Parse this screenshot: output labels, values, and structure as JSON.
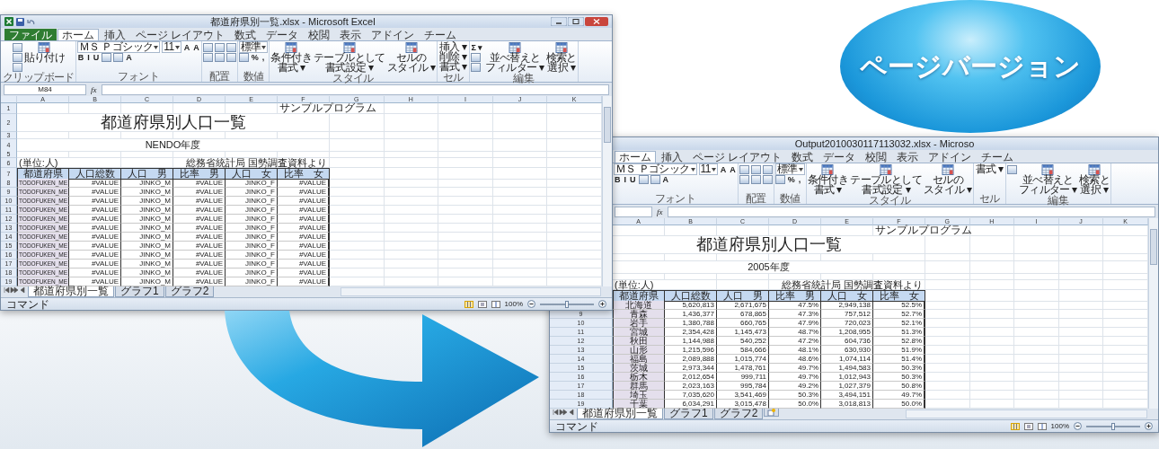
{
  "heading": {
    "text": "ページバージョン"
  },
  "windows": [
    {
      "title": "都道府県別一覧.xlsx - Microsoft Excel",
      "quick_access": true,
      "window_controls": true,
      "tabs": [
        {
          "label": "ファイル",
          "kind": "file",
          "selected": false
        },
        {
          "label": "ホーム",
          "kind": "tab",
          "selected": true
        },
        {
          "label": "挿入",
          "kind": "tab",
          "selected": false
        },
        {
          "label": "ページ レイアウト",
          "kind": "tab",
          "selected": false
        },
        {
          "label": "数式",
          "kind": "tab",
          "selected": false
        },
        {
          "label": "データ",
          "kind": "tab",
          "selected": false
        },
        {
          "label": "校閲",
          "kind": "tab",
          "selected": false
        },
        {
          "label": "表示",
          "kind": "tab",
          "selected": false
        },
        {
          "label": "アドイン",
          "kind": "tab",
          "selected": false
        },
        {
          "label": "チーム",
          "kind": "tab",
          "selected": false
        }
      ],
      "ribbon": [
        {
          "label": "クリップボード",
          "big": [
            {
              "lines": [
                "貼り付け"
              ]
            }
          ],
          "rows": [
            {
              "items": [
                {
                  "kind": "tool"
                }
              ]
            },
            {
              "items": [
                {
                  "kind": "tool"
                }
              ]
            },
            {
              "items": [
                {
                  "kind": "tool"
                }
              ]
            }
          ]
        },
        {
          "label": "フォント",
          "rows": [
            {
              "items": [
                {
                  "kind": "field",
                  "value": "ＭＳ Ｐゴシック"
                },
                {
                  "kind": "field",
                  "value": "11"
                },
                {
                  "kind": "glyph",
                  "text": "A"
                },
                {
                  "kind": "glyph",
                  "text": "A"
                }
              ]
            },
            {
              "items": [
                {
                  "kind": "glyph",
                  "text": "B"
                },
                {
                  "kind": "glyph",
                  "text": "I"
                },
                {
                  "kind": "glyph",
                  "text": "U"
                },
                {
                  "kind": "tool"
                },
                {
                  "kind": "tool"
                },
                {
                  "kind": "glyph",
                  "text": "A"
                }
              ]
            }
          ]
        },
        {
          "label": "配置",
          "rows": [
            {
              "items": [
                {
                  "kind": "tool"
                },
                {
                  "kind": "tool"
                },
                {
                  "kind": "tool"
                }
              ]
            },
            {
              "items": [
                {
                  "kind": "tool"
                },
                {
                  "kind": "tool"
                },
                {
                  "kind": "tool"
                }
              ]
            }
          ]
        },
        {
          "label": "数値",
          "rows": [
            {
              "items": [
                {
                  "kind": "field",
                  "value": "標準"
                }
              ]
            },
            {
              "items": [
                {
                  "kind": "tool"
                },
                {
                  "kind": "glyph",
                  "text": "%"
                },
                {
                  "kind": "glyph",
                  "text": ","
                }
              ]
            }
          ]
        },
        {
          "label": "スタイル",
          "big": [
            {
              "lines": [
                "条件付き",
                "書式 ▾"
              ]
            },
            {
              "lines": [
                "テーブルとして",
                "書式設定 ▾"
              ]
            },
            {
              "lines": [
                "セルの",
                "スタイル ▾"
              ]
            }
          ]
        },
        {
          "label": "セル",
          "rows": [
            {
              "items": [
                {
                  "kind": "button",
                  "text": "挿入 ▾"
                }
              ]
            },
            {
              "items": [
                {
                  "kind": "button",
                  "text": "削除 ▾"
                }
              ]
            },
            {
              "items": [
                {
                  "kind": "button",
                  "text": "書式 ▾"
                }
              ]
            }
          ]
        },
        {
          "label": "編集",
          "rows": [
            {
              "items": [
                {
                  "kind": "glyph",
                  "text": "Σ ▾"
                }
              ]
            },
            {
              "items": [
                {
                  "kind": "tool"
                }
              ]
            },
            {
              "items": [
                {
                  "kind": "tool"
                }
              ]
            }
          ],
          "big": [
            {
              "lines": [
                "並べ替えと",
                "フィルター ▾"
              ]
            },
            {
              "lines": [
                "検索と",
                "選択 ▾"
              ]
            }
          ]
        }
      ],
      "name_box": "M84",
      "formula_label": "fx",
      "columns": [
        "A",
        "B",
        "C",
        "D",
        "E",
        "F",
        "G",
        "H",
        "I",
        "J",
        "K"
      ],
      "rows": [
        {
          "n": "1",
          "kind": "corner",
          "label": "サンプルプログラム"
        },
        {
          "n": "2",
          "kind": "title",
          "title": "都道府県別人口一覧"
        },
        {
          "n": "3",
          "kind": "blank"
        },
        {
          "n": "4",
          "kind": "subtitle",
          "subtitle": "NENDO年度"
        },
        {
          "n": "5",
          "kind": "blank"
        },
        {
          "n": "6",
          "kind": "notes",
          "left": "(単位:人)",
          "right": "総務省統計局 国勢調査資料より"
        },
        {
          "n": "7",
          "kind": "header",
          "cells": [
            "都道府県",
            "人口総数",
            "人口　男",
            "比率　男",
            "人口　女",
            "比率　女"
          ]
        },
        {
          "n": "8",
          "kind": "data",
          "cells": [
            "TODOFUKEN_ME",
            "#VALUE",
            "JINKO_M",
            "#VALUE",
            "JINKO_F",
            "#VALUE"
          ]
        },
        {
          "n": "9",
          "kind": "data",
          "cells": [
            "TODOFUKEN_ME",
            "#VALUE",
            "JINKO_M",
            "#VALUE",
            "JINKO_F",
            "#VALUE"
          ]
        },
        {
          "n": "10",
          "kind": "data",
          "cells": [
            "TODOFUKEN_ME",
            "#VALUE",
            "JINKO_M",
            "#VALUE",
            "JINKO_F",
            "#VALUE"
          ]
        },
        {
          "n": "11",
          "kind": "data",
          "cells": [
            "TODOFUKEN_ME",
            "#VALUE",
            "JINKO_M",
            "#VALUE",
            "JINKO_F",
            "#VALUE"
          ]
        },
        {
          "n": "12",
          "kind": "data",
          "cells": [
            "TODOFUKEN_ME",
            "#VALUE",
            "JINKO_M",
            "#VALUE",
            "JINKO_F",
            "#VALUE"
          ]
        },
        {
          "n": "13",
          "kind": "data",
          "cells": [
            "TODOFUKEN_ME",
            "#VALUE",
            "JINKO_M",
            "#VALUE",
            "JINKO_F",
            "#VALUE"
          ]
        },
        {
          "n": "14",
          "kind": "data",
          "cells": [
            "TODOFUKEN_ME",
            "#VALUE",
            "JINKO_M",
            "#VALUE",
            "JINKO_F",
            "#VALUE"
          ]
        },
        {
          "n": "15",
          "kind": "data",
          "cells": [
            "TODOFUKEN_ME",
            "#VALUE",
            "JINKO_M",
            "#VALUE",
            "JINKO_F",
            "#VALUE"
          ]
        },
        {
          "n": "16",
          "kind": "data",
          "cells": [
            "TODOFUKEN_ME",
            "#VALUE",
            "JINKO_M",
            "#VALUE",
            "JINKO_F",
            "#VALUE"
          ]
        },
        {
          "n": "17",
          "kind": "data",
          "cells": [
            "TODOFUKEN_ME",
            "#VALUE",
            "JINKO_M",
            "#VALUE",
            "JINKO_F",
            "#VALUE"
          ]
        },
        {
          "n": "18",
          "kind": "data",
          "cells": [
            "TODOFUKEN_ME",
            "#VALUE",
            "JINKO_M",
            "#VALUE",
            "JINKO_F",
            "#VALUE"
          ]
        },
        {
          "n": "19",
          "kind": "data",
          "cells": [
            "TODOFUKEN_ME",
            "#VALUE",
            "JINKO_M",
            "#VALUE",
            "JINKO_F",
            "#VALUE"
          ]
        }
      ],
      "sheet_tabs": [
        {
          "label": "都道府県別一覧",
          "kind": "sheet",
          "selected": true
        },
        {
          "label": "グラフ1",
          "kind": "sheet",
          "selected": false
        },
        {
          "label": "グラフ2",
          "kind": "sheet",
          "selected": false
        }
      ],
      "status": "コマンド",
      "zoom": "100%",
      "zoom_slider": {
        "level": 0.5
      }
    },
    {
      "title": "Output2010030117113032.xlsx - Microso",
      "tabs": [
        {
          "label": "ホーム",
          "kind": "tab",
          "selected": true
        },
        {
          "label": "挿入",
          "kind": "tab",
          "selected": false
        },
        {
          "label": "ページ レイアウト",
          "kind": "tab",
          "selected": false
        },
        {
          "label": "数式",
          "kind": "tab",
          "selected": false
        },
        {
          "label": "データ",
          "kind": "tab",
          "selected": false
        },
        {
          "label": "校閲",
          "kind": "tab",
          "selected": false
        },
        {
          "label": "表示",
          "kind": "tab",
          "selected": false
        },
        {
          "label": "アドイン",
          "kind": "tab",
          "selected": false
        },
        {
          "label": "チーム",
          "kind": "tab",
          "selected": false
        }
      ],
      "ribbon": [
        {
          "label": "フォント",
          "rows": [
            {
              "items": [
                {
                  "kind": "field",
                  "value": "ＭＳ Ｐゴシック"
                },
                {
                  "kind": "field",
                  "value": "11"
                },
                {
                  "kind": "glyph",
                  "text": "A"
                },
                {
                  "kind": "glyph",
                  "text": "A"
                }
              ]
            },
            {
              "items": [
                {
                  "kind": "glyph",
                  "text": "B"
                },
                {
                  "kind": "glyph",
                  "text": "I"
                },
                {
                  "kind": "glyph",
                  "text": "U"
                },
                {
                  "kind": "tool"
                },
                {
                  "kind": "tool"
                },
                {
                  "kind": "glyph",
                  "text": "A"
                }
              ]
            }
          ]
        },
        {
          "label": "配置",
          "rows": [
            {
              "items": [
                {
                  "kind": "tool"
                },
                {
                  "kind": "tool"
                },
                {
                  "kind": "tool"
                }
              ]
            },
            {
              "items": [
                {
                  "kind": "tool"
                },
                {
                  "kind": "tool"
                },
                {
                  "kind": "tool"
                }
              ]
            }
          ]
        },
        {
          "label": "数値",
          "rows": [
            {
              "items": [
                {
                  "kind": "field",
                  "value": "標準"
                }
              ]
            },
            {
              "items": [
                {
                  "kind": "tool"
                },
                {
                  "kind": "glyph",
                  "text": "%"
                },
                {
                  "kind": "glyph",
                  "text": ","
                }
              ]
            }
          ]
        },
        {
          "label": "スタイル",
          "big": [
            {
              "lines": [
                "条件付き",
                "書式 ▾"
              ]
            },
            {
              "lines": [
                "テーブルとして",
                "書式設定 ▾"
              ]
            },
            {
              "lines": [
                "セルの",
                "スタイル ▾"
              ]
            }
          ]
        },
        {
          "label": "セル",
          "rows": [
            {
              "items": [
                {
                  "kind": "button",
                  "text": "書式 ▾"
                }
              ]
            }
          ]
        },
        {
          "label": "編集",
          "rows": [
            {
              "items": [
                {
                  "kind": "tool"
                }
              ]
            }
          ],
          "big": [
            {
              "lines": [
                "並べ替えと",
                "フィルター ▾"
              ]
            },
            {
              "lines": [
                "検索と",
                "選択 ▾"
              ]
            }
          ]
        }
      ],
      "formula_label": "fx",
      "columns": [
        "A",
        "B",
        "C",
        "D",
        "E",
        "F",
        "G",
        "H",
        "I",
        "J",
        "K"
      ],
      "rows": [
        {
          "kind": "corner",
          "label": "サンプルプログラム"
        },
        {
          "kind": "title",
          "title": "都道府県別人口一覧"
        },
        {
          "kind": "blank"
        },
        {
          "kind": "subtitle",
          "subtitle": "2005年度"
        },
        {
          "kind": "blank"
        },
        {
          "kind": "notes",
          "left": "(単位:人)",
          "right": "総務省統計局 国勢調査資料より"
        },
        {
          "kind": "header",
          "cells": [
            "都道府県",
            "人口総数",
            "人口　男",
            "比率　男",
            "人口　女",
            "比率　女"
          ]
        },
        {
          "kind": "data",
          "cells": [
            "北海道",
            "5,620,813",
            "2,671,675",
            "47.5%",
            "2,949,138",
            "52.5%"
          ]
        },
        {
          "n": "9",
          "kind": "data",
          "cells": [
            "青森",
            "1,436,377",
            "678,865",
            "47.3%",
            "757,512",
            "52.7%"
          ]
        },
        {
          "n": "10",
          "kind": "data",
          "cells": [
            "岩手",
            "1,380,788",
            "660,765",
            "47.9%",
            "720,023",
            "52.1%"
          ]
        },
        {
          "n": "11",
          "kind": "data",
          "cells": [
            "宮城",
            "2,354,428",
            "1,145,473",
            "48.7%",
            "1,208,955",
            "51.3%"
          ]
        },
        {
          "n": "12",
          "kind": "data",
          "cells": [
            "秋田",
            "1,144,988",
            "540,252",
            "47.2%",
            "604,736",
            "52.8%"
          ]
        },
        {
          "n": "13",
          "kind": "data",
          "cells": [
            "山形",
            "1,215,596",
            "584,666",
            "48.1%",
            "630,930",
            "51.9%"
          ]
        },
        {
          "n": "14",
          "kind": "data",
          "cells": [
            "福島",
            "2,089,888",
            "1,015,774",
            "48.6%",
            "1,074,114",
            "51.4%"
          ]
        },
        {
          "n": "15",
          "kind": "data",
          "cells": [
            "茨城",
            "2,973,344",
            "1,478,761",
            "49.7%",
            "1,494,583",
            "50.3%"
          ]
        },
        {
          "n": "16",
          "kind": "data",
          "cells": [
            "栃木",
            "2,012,654",
            "999,711",
            "49.7%",
            "1,012,943",
            "50.3%"
          ]
        },
        {
          "n": "17",
          "kind": "data",
          "cells": [
            "群馬",
            "2,023,163",
            "995,784",
            "49.2%",
            "1,027,379",
            "50.8%"
          ]
        },
        {
          "n": "18",
          "kind": "data",
          "cells": [
            "埼玉",
            "7,035,620",
            "3,541,469",
            "50.3%",
            "3,494,151",
            "49.7%"
          ]
        },
        {
          "n": "19",
          "kind": "data",
          "cells": [
            "千葉",
            "6,034,291",
            "3,015,478",
            "50.0%",
            "3,018,813",
            "50.0%"
          ]
        }
      ],
      "sheet_tabs": [
        {
          "label": "都道府県別一覧",
          "kind": "sheet",
          "selected": true
        },
        {
          "label": "グラフ1",
          "kind": "sheet",
          "selected": false
        },
        {
          "label": "グラフ2",
          "kind": "sheet",
          "selected": false
        },
        {
          "kind": "new",
          "selected": false
        }
      ],
      "status": "コマンド",
      "zoom": "100%",
      "zoom_slider": {
        "level": 0.5
      }
    }
  ]
}
